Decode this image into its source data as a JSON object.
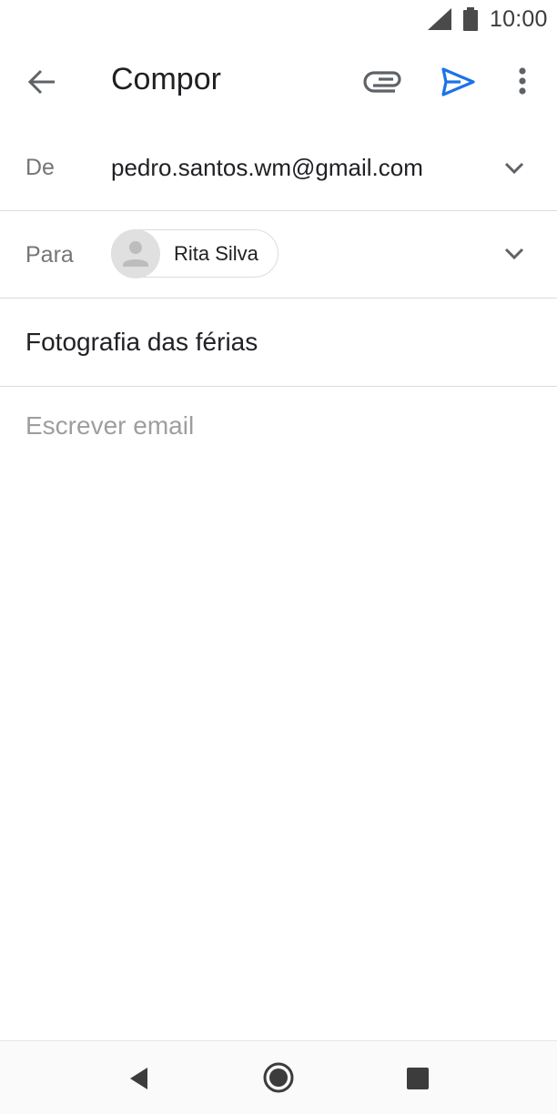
{
  "status_bar": {
    "time": "10:00",
    "icons": [
      "signal-icon",
      "battery-icon"
    ]
  },
  "app_bar": {
    "title": "Compor",
    "icons": [
      "back-arrow-icon",
      "paperclip-icon",
      "send-icon",
      "more-vert-icon"
    ]
  },
  "compose": {
    "from_label": "De",
    "from_value": "pedro.santos.wm@gmail.com",
    "to_label": "Para",
    "to_recipients": [
      {
        "name": "Rita Silva",
        "avatar": "person-avatar-icon"
      }
    ],
    "subject_value": "Fotografia das férias",
    "body_placeholder": "Escrever email"
  },
  "nav_bar": {
    "icons": [
      "nav-back-icon",
      "nav-home-icon",
      "nav-recents-icon"
    ]
  },
  "colors": {
    "accent": "#1a73e8",
    "text_primary": "#202124",
    "text_secondary": "#757575",
    "placeholder": "#9e9e9e",
    "divider": "#dadce0"
  }
}
